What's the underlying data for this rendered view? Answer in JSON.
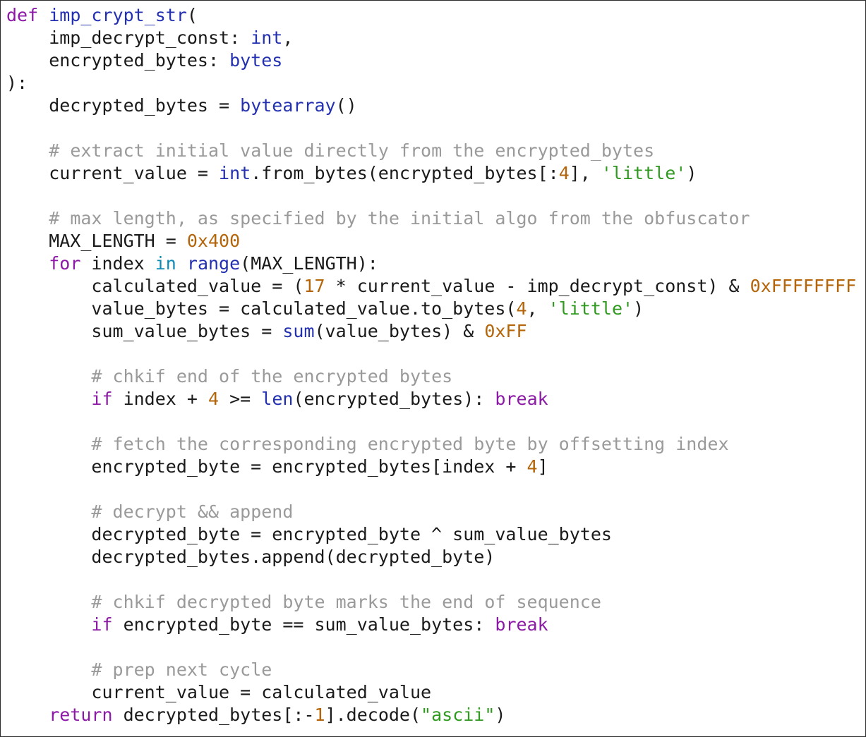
{
  "colors": {
    "keyword": "#8c1aa6",
    "function": "#2330b0",
    "builtin": "#2330b0",
    "operator_keyword": "#0d8ab7",
    "number": "#b4650a",
    "string": "#2f9a1f",
    "comment": "#9a9a9a",
    "plain": "#1a1a1a",
    "border": "#2b2b2b",
    "background": "#ffffff"
  },
  "code": {
    "language": "python",
    "lines": [
      [
        [
          "kw",
          "def"
        ],
        [
          "plain",
          " "
        ],
        [
          "fn",
          "imp_crypt_str"
        ],
        [
          "plain",
          "("
        ]
      ],
      [
        [
          "plain",
          "    imp_decrypt_const: "
        ],
        [
          "bi",
          "int"
        ],
        [
          "plain",
          ","
        ]
      ],
      [
        [
          "plain",
          "    encrypted_bytes: "
        ],
        [
          "bi",
          "bytes"
        ]
      ],
      [
        [
          "plain",
          "):"
        ]
      ],
      [
        [
          "plain",
          "    decrypted_bytes = "
        ],
        [
          "bi",
          "bytearray"
        ],
        [
          "plain",
          "()"
        ]
      ],
      [
        [
          "plain",
          ""
        ]
      ],
      [
        [
          "plain",
          "    "
        ],
        [
          "com",
          "# extract initial value directly from the encrypted_bytes"
        ]
      ],
      [
        [
          "plain",
          "    current_value = "
        ],
        [
          "bi",
          "int"
        ],
        [
          "plain",
          ".from_bytes(encrypted_bytes[:"
        ],
        [
          "num",
          "4"
        ],
        [
          "plain",
          "], "
        ],
        [
          "str",
          "'little'"
        ],
        [
          "plain",
          ")"
        ]
      ],
      [
        [
          "plain",
          ""
        ]
      ],
      [
        [
          "plain",
          "    "
        ],
        [
          "com",
          "# max length, as specified by the initial algo from the obfuscator"
        ]
      ],
      [
        [
          "plain",
          "    MAX_LENGTH = "
        ],
        [
          "num",
          "0x400"
        ]
      ],
      [
        [
          "plain",
          "    "
        ],
        [
          "kw",
          "for"
        ],
        [
          "plain",
          " index "
        ],
        [
          "op",
          "in"
        ],
        [
          "plain",
          " "
        ],
        [
          "bi",
          "range"
        ],
        [
          "plain",
          "(MAX_LENGTH):"
        ]
      ],
      [
        [
          "plain",
          "        calculated_value = ("
        ],
        [
          "num",
          "17"
        ],
        [
          "plain",
          " * current_value - imp_decrypt_const) & "
        ],
        [
          "num",
          "0xFFFFFFFF"
        ]
      ],
      [
        [
          "plain",
          "        value_bytes = calculated_value.to_bytes("
        ],
        [
          "num",
          "4"
        ],
        [
          "plain",
          ", "
        ],
        [
          "str",
          "'little'"
        ],
        [
          "plain",
          ")"
        ]
      ],
      [
        [
          "plain",
          "        sum_value_bytes = "
        ],
        [
          "bi",
          "sum"
        ],
        [
          "plain",
          "(value_bytes) & "
        ],
        [
          "num",
          "0xFF"
        ]
      ],
      [
        [
          "plain",
          ""
        ]
      ],
      [
        [
          "plain",
          "        "
        ],
        [
          "com",
          "# chkif end of the encrypted bytes"
        ]
      ],
      [
        [
          "plain",
          "        "
        ],
        [
          "kw",
          "if"
        ],
        [
          "plain",
          " index + "
        ],
        [
          "num",
          "4"
        ],
        [
          "plain",
          " >= "
        ],
        [
          "bi",
          "len"
        ],
        [
          "plain",
          "(encrypted_bytes): "
        ],
        [
          "kw",
          "break"
        ]
      ],
      [
        [
          "plain",
          ""
        ]
      ],
      [
        [
          "plain",
          "        "
        ],
        [
          "com",
          "# fetch the corresponding encrypted byte by offsetting index"
        ]
      ],
      [
        [
          "plain",
          "        encrypted_byte = encrypted_bytes[index + "
        ],
        [
          "num",
          "4"
        ],
        [
          "plain",
          "]"
        ]
      ],
      [
        [
          "plain",
          ""
        ]
      ],
      [
        [
          "plain",
          "        "
        ],
        [
          "com",
          "# decrypt && append"
        ]
      ],
      [
        [
          "plain",
          "        decrypted_byte = encrypted_byte ^ sum_value_bytes"
        ]
      ],
      [
        [
          "plain",
          "        decrypted_bytes.append(decrypted_byte)"
        ]
      ],
      [
        [
          "plain",
          ""
        ]
      ],
      [
        [
          "plain",
          "        "
        ],
        [
          "com",
          "# chkif decrypted byte marks the end of sequence"
        ]
      ],
      [
        [
          "plain",
          "        "
        ],
        [
          "kw",
          "if"
        ],
        [
          "plain",
          " encrypted_byte == sum_value_bytes: "
        ],
        [
          "kw",
          "break"
        ]
      ],
      [
        [
          "plain",
          ""
        ]
      ],
      [
        [
          "plain",
          "        "
        ],
        [
          "com",
          "# prep next cycle"
        ]
      ],
      [
        [
          "plain",
          "        current_value = calculated_value"
        ]
      ],
      [
        [
          "plain",
          "    "
        ],
        [
          "kw",
          "return"
        ],
        [
          "plain",
          " decrypted_bytes[:-"
        ],
        [
          "num",
          "1"
        ],
        [
          "plain",
          "].decode("
        ],
        [
          "str",
          "\"ascii\""
        ],
        [
          "plain",
          ")"
        ]
      ]
    ]
  }
}
